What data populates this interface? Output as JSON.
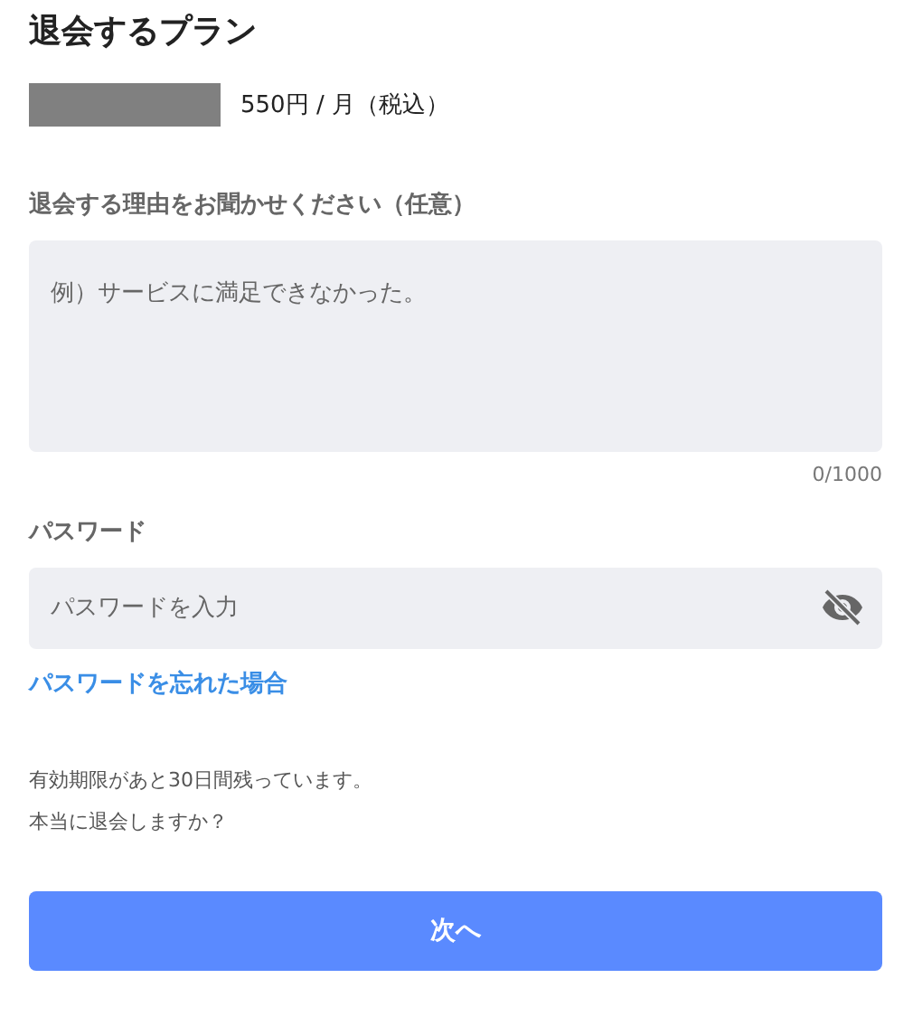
{
  "title": "退会するプラン",
  "plan": {
    "price": "550円 / 月（税込）"
  },
  "reason": {
    "label": "退会する理由をお聞かせください（任意）",
    "placeholder": "例）サービスに満足できなかった。",
    "counter": "0/1000"
  },
  "password": {
    "label": "パスワード",
    "placeholder": "パスワードを入力",
    "visible": false
  },
  "forgot_link": "パスワードを忘れた場合",
  "notes": [
    "有効期限があと30日間残っています。",
    "本当に退会しますか？"
  ],
  "next_button": "次へ"
}
